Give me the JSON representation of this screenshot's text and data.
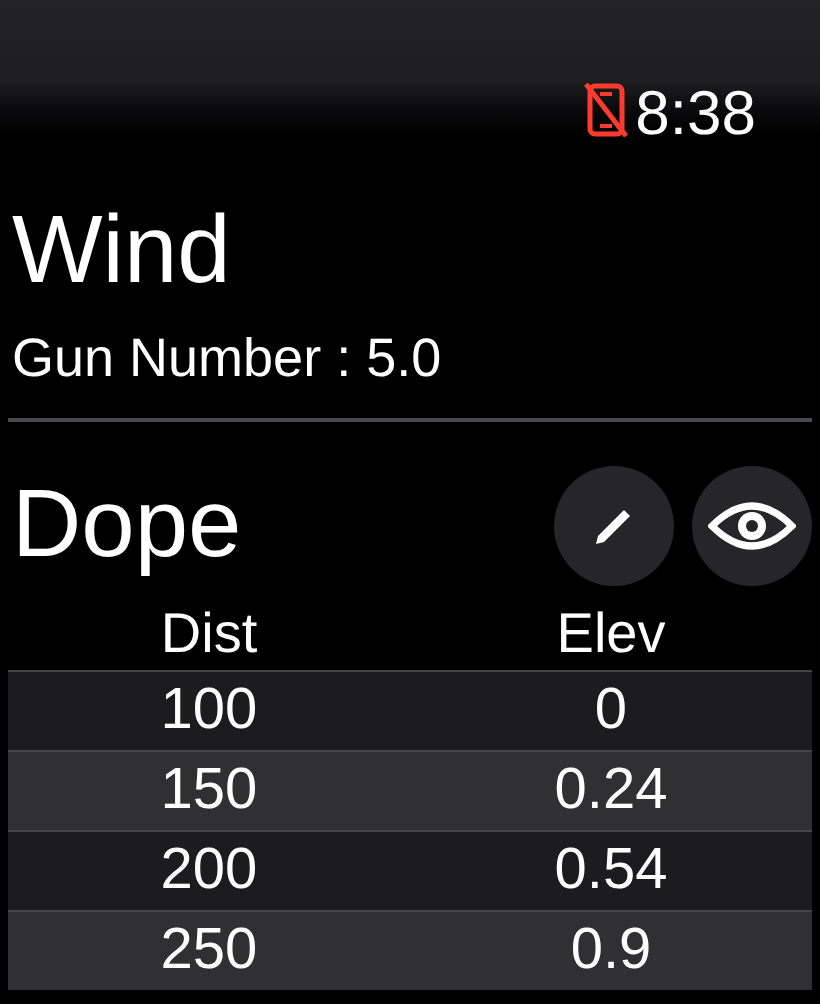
{
  "status_bar": {
    "time": "8:38"
  },
  "title": "Wind",
  "subtitle": "Gun Number : 5.0",
  "section": {
    "title": "Dope"
  },
  "table": {
    "columns": [
      "Dist",
      "Elev"
    ],
    "rows": [
      [
        "100",
        "0"
      ],
      [
        "150",
        "0.24"
      ],
      [
        "200",
        "0.54"
      ],
      [
        "250",
        "0.9"
      ]
    ]
  }
}
